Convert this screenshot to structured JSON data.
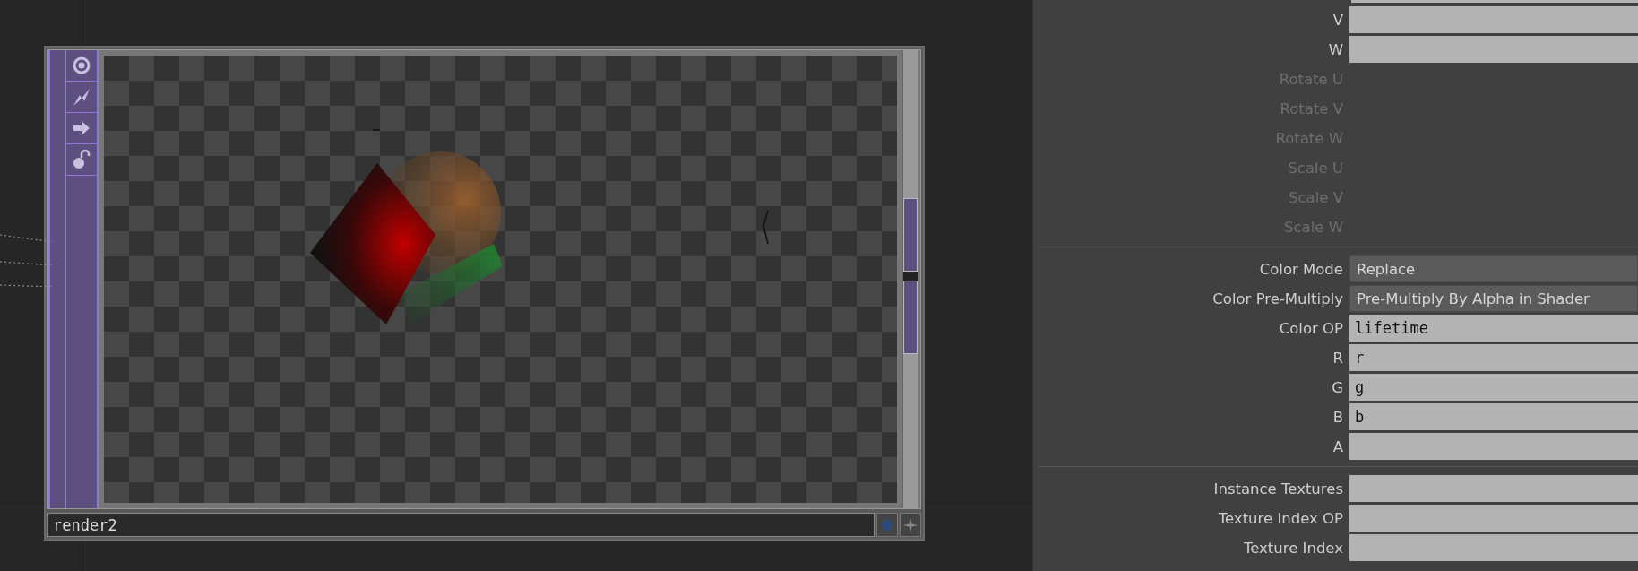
{
  "node": {
    "name": "render2",
    "tools": [
      {
        "kind": "ring"
      },
      {
        "kind": "lightning"
      },
      {
        "kind": "arrow"
      },
      {
        "kind": "padlock"
      }
    ]
  },
  "parameters": [
    [
      {
        "label": "V",
        "kind": "field",
        "disabled": false
      },
      {
        "label": "W",
        "kind": "field",
        "disabled": false
      },
      {
        "label": "Rotate U",
        "kind": "none",
        "disabled": true
      },
      {
        "label": "Rotate V",
        "kind": "none",
        "disabled": true
      },
      {
        "label": "Rotate W",
        "kind": "none",
        "disabled": true
      },
      {
        "label": "Scale U",
        "kind": "none",
        "disabled": true
      },
      {
        "label": "Scale V",
        "kind": "none",
        "disabled": true
      },
      {
        "label": "Scale W",
        "kind": "none",
        "disabled": true
      }
    ],
    [
      {
        "label": "Color Mode",
        "kind": "menu",
        "value": "Replace",
        "disabled": false
      },
      {
        "label": "Color Pre-Multiply",
        "kind": "menu",
        "value": "Pre-Multiply By Alpha in Shader",
        "disabled": false
      },
      {
        "label": "Color OP",
        "kind": "field",
        "value": "lifetime",
        "disabled": false
      },
      {
        "label": "R",
        "kind": "field",
        "value": "r",
        "disabled": false
      },
      {
        "label": "G",
        "kind": "field",
        "value": "g",
        "disabled": false
      },
      {
        "label": "B",
        "kind": "field",
        "value": "b",
        "disabled": false
      },
      {
        "label": "A",
        "kind": "field",
        "disabled": false
      }
    ],
    [
      {
        "label": "Instance Textures",
        "kind": "field",
        "disabled": false
      },
      {
        "label": "Texture Index OP",
        "kind": "field",
        "disabled": false
      },
      {
        "label": "Texture Index",
        "kind": "field",
        "disabled": false
      }
    ]
  ]
}
